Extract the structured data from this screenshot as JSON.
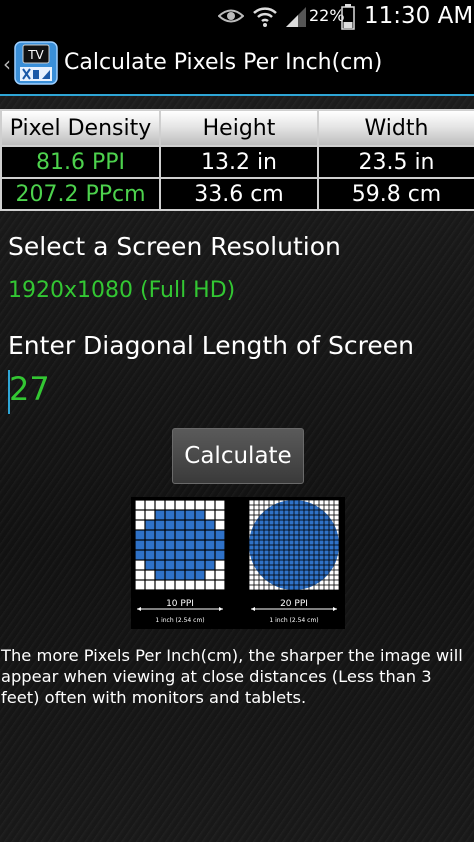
{
  "status_bar": {
    "battery_percent": "22%",
    "time": "11:30 AM",
    "icons": [
      "eye-icon",
      "wifi-icon",
      "signal-icon",
      "battery-icon"
    ]
  },
  "action_bar": {
    "title": "Calculate Pixels Per Inch(cm)",
    "icon_text": "TV"
  },
  "results": {
    "headers": [
      "Pixel Density",
      "Height",
      "Width"
    ],
    "rows": [
      [
        "81.6  PPI",
        "13.2  in",
        "23.5  in"
      ],
      [
        "207.2  PPcm",
        "33.6  cm",
        "59.8  cm"
      ]
    ]
  },
  "resolution": {
    "label": "Select a Screen Resolution",
    "value": "1920x1080 (Full HD)"
  },
  "diagonal": {
    "label": "Enter Diagonal Length of Screen",
    "value": "27"
  },
  "calculate_label": "Calculate",
  "illustration": {
    "left_label": "10 PPI",
    "right_label": "20 PPI",
    "left_caption": "1 inch (2.54 cm)",
    "right_caption": "1 inch (2.54 cm)"
  },
  "description": "The more Pixels Per Inch(cm), the sharper the image will appear when viewing at close distances (Less than 3 feet) often with monitors and tablets.",
  "colors": {
    "accent": "#2fa6d6",
    "green": "#33c733",
    "circle_blue": "#2f72c8"
  }
}
